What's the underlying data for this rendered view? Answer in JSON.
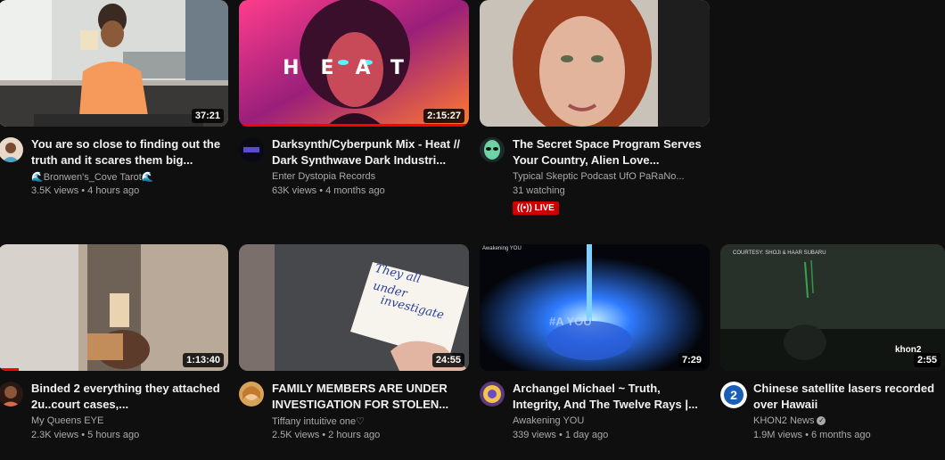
{
  "colors": {
    "background": "#0f0f0f",
    "title": "#f1f1f1",
    "meta": "#aaaaaa",
    "live": "#cc0000",
    "progress": "#ff0000"
  },
  "videos": [
    {
      "title": "You are so close to finding out the truth and it scares them big...",
      "channel": "🌊Bronwen's_Cove Tarot🌊",
      "stats": "3.5K views • 4 hours ago",
      "duration": "37:21",
      "progress": 0
    },
    {
      "title": "Darksynth/Cyberpunk Mix - Heat // Dark Synthwave Dark Industri...",
      "channel": "Enter Dystopia Records",
      "stats": "63K views • 4 months ago",
      "duration": "2:15:27",
      "progress": 1.0,
      "thumb_text": "HEAT"
    },
    {
      "title": "The Secret Space Program Serves Your Country, Alien Love...",
      "channel": "Typical Skeptic Podcast UfO PaRaNo...",
      "stats": "31 watching",
      "live_label": "LIVE",
      "live_icon": "broadcast-icon"
    },
    {
      "title": "Binded 2 everything they attached 2u..court cases,...",
      "channel": "My Queens EYE",
      "stats": "2.3K views • 5 hours ago",
      "duration": "1:13:40",
      "progress": 0.09
    },
    {
      "title": "FAMILY MEMBERS ARE UNDER INVESTIGATION FOR STOLEN...",
      "channel": "Tiffany intuitive one♡",
      "stats": "2.5K views • 2 hours ago",
      "duration": "24:55",
      "progress": 0,
      "thumb_text_1": "They all",
      "thumb_text_2": "under",
      "thumb_text_3": "investigate"
    },
    {
      "title": "Archangel Michael ~ Truth, Integrity, And The Twelve Rays |...",
      "channel": "Awakening YOU",
      "stats": "339 views • 1 day ago",
      "duration": "7:29",
      "progress": 0,
      "thumb_text": "#A  YOU",
      "thumb_corner": "Awakening YOU"
    },
    {
      "title": "Chinese satellite lasers recorded over Hawaii",
      "channel": "KHON2 News",
      "verified_icon": "check-icon",
      "stats": "1.9M views • 6 months ago",
      "duration": "2:55",
      "progress": 0,
      "thumb_credit": "COURTESY: SHOJI & HAAR SUBARU",
      "thumb_logo": "khon2",
      "more_icon": "more-vert-icon"
    }
  ]
}
